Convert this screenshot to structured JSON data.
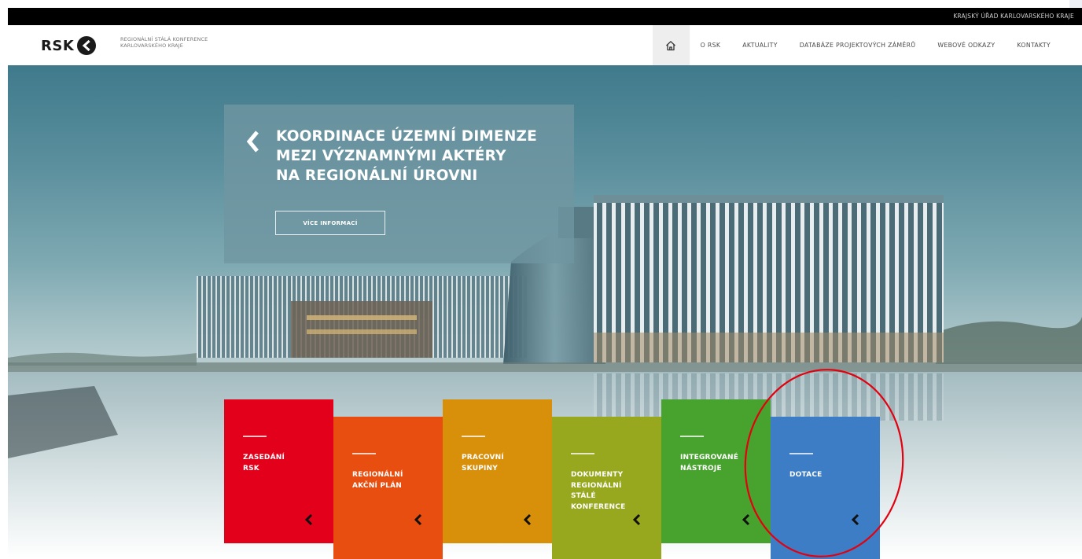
{
  "topbar": {
    "link": "KRAJSKÝ ÚŘAD KARLOVARSKÉHO KRAJE"
  },
  "header": {
    "logo_text": "RSK",
    "tagline_line1": "REGIONÁLNÍ STÁLÁ KONFERENCE",
    "tagline_line2": "KARLOVARSKÉHO KRAJE"
  },
  "nav": {
    "home_icon": "home-icon",
    "items": [
      "O RSK",
      "AKTUALITY",
      "DATABÁZE PROJEKTOVÝCH ZÁMĚRŮ",
      "WEBOVÉ ODKAZY",
      "KONTAKTY"
    ]
  },
  "hero": {
    "title_line1": "KOORDINACE ÚZEMNÍ DIMENZE",
    "title_line2": "MEZI VÝZNAMNÝMI AKTÉRY",
    "title_line3": "NA REGIONÁLNÍ ÚROVNI",
    "button": "VÍCE INFORMACÍ",
    "arrow_icon": "chevron-left-icon"
  },
  "tiles": [
    {
      "lines": [
        "ZASEDÁNÍ",
        "RSK"
      ],
      "color": "#e2001a"
    },
    {
      "lines": [
        "REGIONÁLNÍ",
        "AKČNÍ PLÁN"
      ],
      "color": "#e84e0f"
    },
    {
      "lines": [
        "PRACOVNÍ",
        "SKUPINY"
      ],
      "color": "#d8900a"
    },
    {
      "lines": [
        "DOKUMENTY",
        "REGIONÁLNÍ",
        "STÁLÉ",
        "KONFERENCE"
      ],
      "color": "#97a81f"
    },
    {
      "lines": [
        "INTEGROVANÉ",
        "NÁSTROJE"
      ],
      "color": "#48a32e"
    },
    {
      "lines": [
        "DOTACE"
      ],
      "color": "#3d7dc5"
    }
  ],
  "annotation": {
    "color": "#e3000f"
  }
}
